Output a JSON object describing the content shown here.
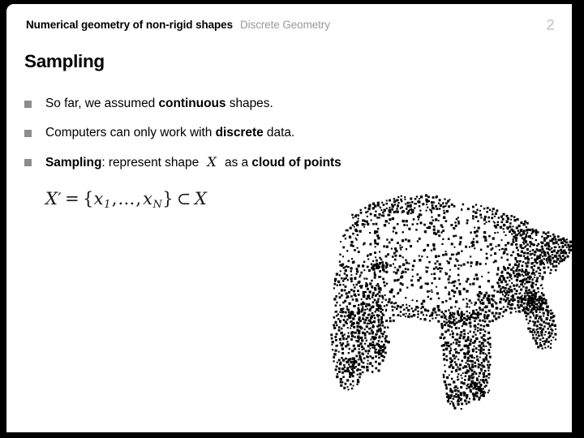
{
  "slide": {
    "header": {
      "title": "Numerical geometry of non-rigid shapes",
      "subtitle": "Discrete Geometry"
    },
    "page_number": "2",
    "title": "Sampling",
    "bullets": [
      {
        "marker": "square-bullet",
        "segments": [
          {
            "text": "So far, we assumed ",
            "bold": false
          },
          {
            "text": "continuous",
            "bold": true
          },
          {
            "text": " shapes.",
            "bold": false
          }
        ]
      },
      {
        "marker": "square-bullet",
        "segments": [
          {
            "text": "Computers can only work with ",
            "bold": false
          },
          {
            "text": "discrete",
            "bold": true
          },
          {
            "text": " data.",
            "bold": false
          }
        ]
      },
      {
        "marker": "square-bullet",
        "segments": [
          {
            "text": "Sampling",
            "bold": true
          },
          {
            "text": ": represent shape ",
            "bold": false
          },
          {
            "text": "X",
            "bold": false,
            "math": true
          },
          {
            "text": " as a ",
            "bold": false
          },
          {
            "text": "cloud of points",
            "bold": true
          }
        ]
      }
    ],
    "formula": {
      "plain": "X' = {x_1, ..., x_N} ⊂ X",
      "lhs": "X",
      "prime": "′",
      "equals": "=",
      "open_brace": "{",
      "first_element": "x",
      "first_index": "1",
      "ellipsis": "…",
      "last_element": "x",
      "last_index": "N",
      "close_brace": "}",
      "subset": "⊂",
      "rhs": "X"
    },
    "figure": {
      "name": "horse-point-cloud",
      "caption": "",
      "point_color": "#000000",
      "background": "#ffffff"
    },
    "colors": {
      "frame": "#000000",
      "canvas": "#ffffff",
      "header_main": "#000000",
      "header_sub": "#999999",
      "page_number": "#d4d4d4",
      "bullet_marker": "#8c8c8c",
      "body_text": "#000000"
    }
  }
}
